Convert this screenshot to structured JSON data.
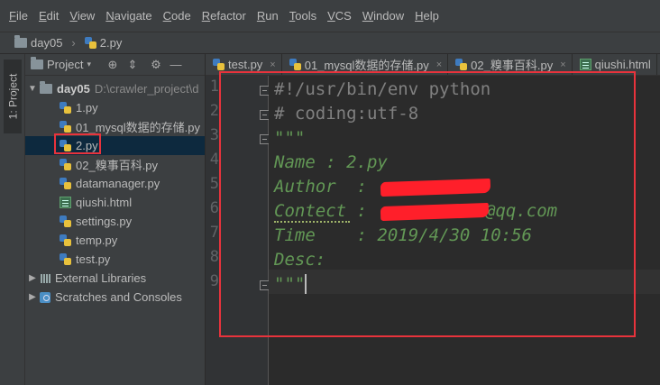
{
  "menubar": {
    "items": [
      {
        "u": "F",
        "rest": "ile"
      },
      {
        "u": "E",
        "rest": "dit"
      },
      {
        "u": "V",
        "rest": "iew"
      },
      {
        "u": "N",
        "rest": "avigate"
      },
      {
        "u": "C",
        "rest": "ode"
      },
      {
        "u": "R",
        "rest": "efactor"
      },
      {
        "u": "R",
        "rest": "un"
      },
      {
        "u": "T",
        "rest": "ools"
      },
      {
        "u": "V",
        "rest": "CS"
      },
      {
        "u": "W",
        "rest": "indow"
      },
      {
        "u": "H",
        "rest": "elp"
      }
    ]
  },
  "breadcrumb": {
    "folder": "day05",
    "file": "2.py"
  },
  "sidebar": {
    "project_tab": "1: Project"
  },
  "project_panel": {
    "title": "Project",
    "root": {
      "name": "day05",
      "path": "D:\\crawler_project\\d"
    },
    "files": [
      {
        "name": "1.py",
        "type": "py"
      },
      {
        "name": "01_mysql数据的存储.py",
        "type": "py"
      },
      {
        "name": "2.py",
        "type": "py"
      },
      {
        "name": "02_糗事百科.py",
        "type": "py"
      },
      {
        "name": "datamanager.py",
        "type": "py"
      },
      {
        "name": "qiushi.html",
        "type": "html"
      },
      {
        "name": "settings.py",
        "type": "py"
      },
      {
        "name": "temp.py",
        "type": "py"
      },
      {
        "name": "test.py",
        "type": "py"
      }
    ],
    "external_libraries": "External Libraries",
    "scratches": "Scratches and Consoles"
  },
  "editor_tabs": [
    {
      "name": "test.py",
      "type": "py",
      "active": false
    },
    {
      "name": "01_mysql数据的存储.py",
      "type": "py",
      "active": false
    },
    {
      "name": "02_糗事百科.py",
      "type": "py",
      "active": false
    },
    {
      "name": "qiushi.html",
      "type": "html",
      "active": false
    }
  ],
  "editor": {
    "line_numbers": [
      "1",
      "2",
      "3",
      "4",
      "5",
      "6",
      "7",
      "8",
      "9"
    ],
    "lines": [
      "#!/usr/bin/env python",
      "# coding:utf-8",
      "\"\"\"",
      "Name : 2.py",
      "Author  : ",
      "Contect : ",
      "Time    : 2019/4/30 10:56",
      "Desc:",
      "\"\"\""
    ],
    "contact_suffix": "@qq.com"
  },
  "colors": {
    "highlight_red": "#e8333c",
    "docstring_green": "#629755",
    "comment_gray": "#808080"
  }
}
